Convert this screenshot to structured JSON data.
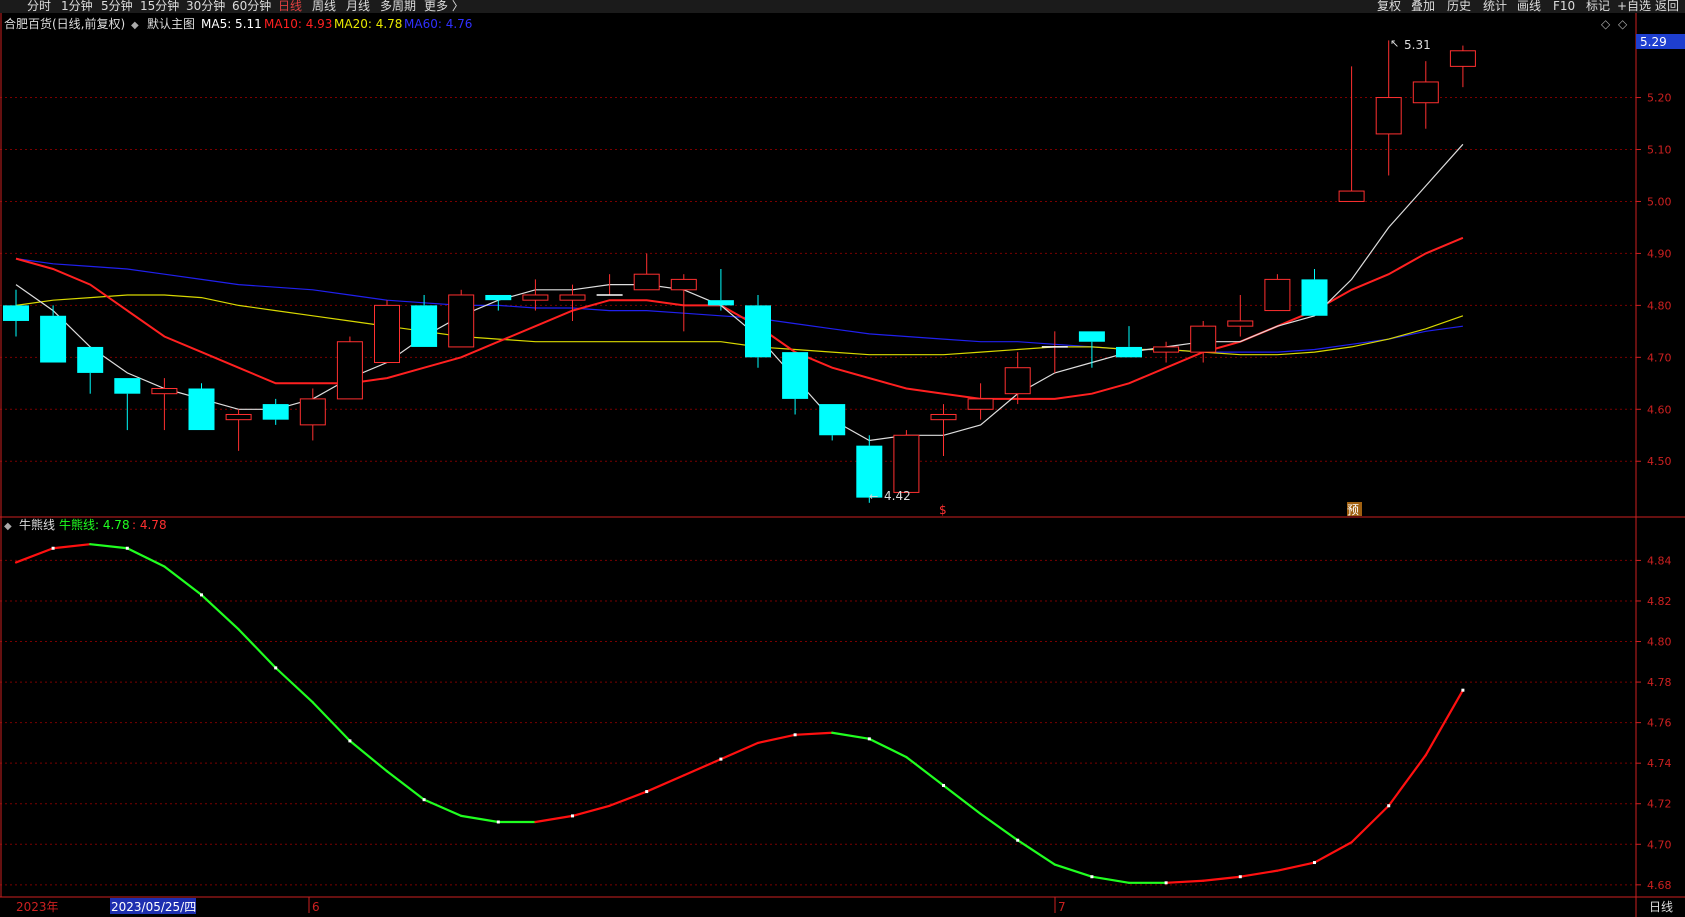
{
  "toolbar": {
    "left": [
      {
        "label": "分时",
        "active": false
      },
      {
        "label": "1分钟",
        "active": false
      },
      {
        "label": "5分钟",
        "active": false
      },
      {
        "label": "15分钟",
        "active": false
      },
      {
        "label": "30分钟",
        "active": false
      },
      {
        "label": "60分钟",
        "active": false
      },
      {
        "label": "日线",
        "active": true
      },
      {
        "label": "周线",
        "active": false
      },
      {
        "label": "月线",
        "active": false
      },
      {
        "label": "多周期",
        "active": false
      },
      {
        "label": "更多 〉",
        "active": false
      }
    ],
    "right": [
      "复权",
      "叠加",
      "历史",
      "统计",
      "画线",
      "F10",
      "标记",
      "+自选",
      "返回"
    ]
  },
  "main_panel": {
    "title": "合肥百货(日线,前复权)",
    "template": "默认主图",
    "indicators": [
      {
        "label": "MA5: 5.11",
        "color": "#ffffff"
      },
      {
        "label": "MA10: 4.93",
        "color": "#ff2020"
      },
      {
        "label": "MA20: 4.78",
        "color": "#e8e800"
      },
      {
        "label": "MA60: 4.76",
        "color": "#3030ff"
      }
    ],
    "price_tag": "5.29",
    "high_label": "5.31",
    "low_label": "4.42",
    "markers": [
      "$",
      "预"
    ]
  },
  "sub_panel": {
    "title": "牛熊线",
    "value_label": "牛熊线: 4.78",
    "value2": ": 4.78"
  },
  "footer": {
    "year": "2023年",
    "cursor_date": "2023/05/25/四",
    "month_labels": [
      "6",
      "7"
    ],
    "period": "日线"
  },
  "colors": {
    "up": "#ff3030",
    "down": "#00ffff",
    "ma5": "#dddddd",
    "ma10": "#ff2020",
    "ma20": "#d8d800",
    "ma60": "#2020ee",
    "bull": "#ff1010",
    "bear": "#20ff20",
    "grid": "#7a0000",
    "axis": "#cc2020"
  },
  "chart_data": [
    {
      "type": "candlestick",
      "title": "合肥百货(日线,前复权)",
      "ylim": [
        4.41,
        5.33
      ],
      "yticks": [
        4.5,
        4.6,
        4.7,
        4.8,
        4.9,
        5.0,
        5.1,
        5.2
      ],
      "candles": [
        {
          "o": 4.8,
          "c": 4.77,
          "h": 4.83,
          "l": 4.74
        },
        {
          "o": 4.78,
          "c": 4.69,
          "h": 4.8,
          "l": 4.69
        },
        {
          "o": 4.72,
          "c": 4.67,
          "h": 4.72,
          "l": 4.63
        },
        {
          "o": 4.66,
          "c": 4.63,
          "h": 4.66,
          "l": 4.56
        },
        {
          "o": 4.63,
          "c": 4.64,
          "h": 4.66,
          "l": 4.56
        },
        {
          "o": 4.64,
          "c": 4.56,
          "h": 4.65,
          "l": 4.56
        },
        {
          "o": 4.58,
          "c": 4.59,
          "h": 4.6,
          "l": 4.52
        },
        {
          "o": 4.61,
          "c": 4.58,
          "h": 4.62,
          "l": 4.57
        },
        {
          "o": 4.57,
          "c": 4.62,
          "h": 4.64,
          "l": 4.54
        },
        {
          "o": 4.62,
          "c": 4.73,
          "h": 4.74,
          "l": 4.62
        },
        {
          "o": 4.69,
          "c": 4.8,
          "h": 4.81,
          "l": 4.69
        },
        {
          "o": 4.8,
          "c": 4.72,
          "h": 4.82,
          "l": 4.72
        },
        {
          "o": 4.72,
          "c": 4.82,
          "h": 4.83,
          "l": 4.72
        },
        {
          "o": 4.82,
          "c": 4.81,
          "h": 4.82,
          "l": 4.79
        },
        {
          "o": 4.81,
          "c": 4.82,
          "h": 4.85,
          "l": 4.79
        },
        {
          "o": 4.81,
          "c": 4.82,
          "h": 4.84,
          "l": 4.77
        },
        {
          "o": 4.82,
          "c": 4.82,
          "h": 4.86,
          "l": 4.82
        },
        {
          "o": 4.83,
          "c": 4.86,
          "h": 4.9,
          "l": 4.83
        },
        {
          "o": 4.83,
          "c": 4.85,
          "h": 4.86,
          "l": 4.75
        },
        {
          "o": 4.81,
          "c": 4.8,
          "h": 4.87,
          "l": 4.79
        },
        {
          "o": 4.8,
          "c": 4.7,
          "h": 4.82,
          "l": 4.68
        },
        {
          "o": 4.71,
          "c": 4.62,
          "h": 4.71,
          "l": 4.59
        },
        {
          "o": 4.61,
          "c": 4.55,
          "h": 4.61,
          "l": 4.54
        },
        {
          "o": 4.53,
          "c": 4.43,
          "h": 4.55,
          "l": 4.42
        },
        {
          "o": 4.44,
          "c": 4.55,
          "h": 4.56,
          "l": 4.44
        },
        {
          "o": 4.58,
          "c": 4.59,
          "h": 4.61,
          "l": 4.51
        },
        {
          "o": 4.6,
          "c": 4.62,
          "h": 4.65,
          "l": 4.58
        },
        {
          "o": 4.63,
          "c": 4.68,
          "h": 4.71,
          "l": 4.61
        },
        {
          "o": 4.72,
          "c": 4.72,
          "h": 4.75,
          "l": 4.67
        },
        {
          "o": 4.75,
          "c": 4.73,
          "h": 4.75,
          "l": 4.68
        },
        {
          "o": 4.72,
          "c": 4.7,
          "h": 4.76,
          "l": 4.7
        },
        {
          "o": 4.71,
          "c": 4.72,
          "h": 4.73,
          "l": 4.69
        },
        {
          "o": 4.71,
          "c": 4.76,
          "h": 4.77,
          "l": 4.69
        },
        {
          "o": 4.76,
          "c": 4.77,
          "h": 4.82,
          "l": 4.74
        },
        {
          "o": 4.79,
          "c": 4.85,
          "h": 4.86,
          "l": 4.79
        },
        {
          "o": 4.85,
          "c": 4.78,
          "h": 4.87,
          "l": 4.78
        },
        {
          "o": 5.0,
          "c": 5.02,
          "h": 5.26,
          "l": 5.0
        },
        {
          "o": 5.13,
          "c": 5.2,
          "h": 5.31,
          "l": 5.05
        },
        {
          "o": 5.19,
          "c": 5.23,
          "h": 5.27,
          "l": 5.14
        },
        {
          "o": 5.26,
          "c": 5.29,
          "h": 5.3,
          "l": 5.22
        }
      ],
      "ma5": [
        4.84,
        4.79,
        4.72,
        4.67,
        4.64,
        4.62,
        4.6,
        4.6,
        4.62,
        4.66,
        4.69,
        4.74,
        4.78,
        4.81,
        4.83,
        4.83,
        4.84,
        4.84,
        4.83,
        4.8,
        4.74,
        4.66,
        4.58,
        4.54,
        4.55,
        4.55,
        4.57,
        4.63,
        4.67,
        4.69,
        4.71,
        4.72,
        4.73,
        4.73,
        4.76,
        4.78,
        4.85,
        4.95,
        5.03,
        5.11
      ],
      "ma10": [
        4.89,
        4.87,
        4.84,
        4.79,
        4.74,
        4.71,
        4.68,
        4.65,
        4.65,
        4.65,
        4.66,
        4.68,
        4.7,
        4.73,
        4.76,
        4.79,
        4.81,
        4.81,
        4.8,
        4.8,
        4.76,
        4.71,
        4.68,
        4.66,
        4.64,
        4.63,
        4.62,
        4.62,
        4.62,
        4.63,
        4.65,
        4.68,
        4.71,
        4.73,
        4.76,
        4.79,
        4.83,
        4.86,
        4.9,
        4.93
      ],
      "ma20": [
        4.8,
        4.81,
        4.815,
        4.82,
        4.82,
        4.815,
        4.8,
        4.79,
        4.78,
        4.77,
        4.76,
        4.75,
        4.74,
        4.735,
        4.73,
        4.73,
        4.73,
        4.73,
        4.73,
        4.73,
        4.72,
        4.715,
        4.71,
        4.705,
        4.705,
        4.705,
        4.71,
        4.715,
        4.72,
        4.72,
        4.715,
        4.715,
        4.71,
        4.705,
        4.705,
        4.71,
        4.72,
        4.735,
        4.755,
        4.78
      ],
      "ma60": [
        4.89,
        4.88,
        4.875,
        4.87,
        4.86,
        4.85,
        4.84,
        4.835,
        4.83,
        4.82,
        4.81,
        4.805,
        4.8,
        4.8,
        4.795,
        4.795,
        4.79,
        4.79,
        4.785,
        4.78,
        4.775,
        4.765,
        4.755,
        4.745,
        4.74,
        4.735,
        4.73,
        4.73,
        4.725,
        4.72,
        4.715,
        4.715,
        4.71,
        4.71,
        4.71,
        4.715,
        4.725,
        4.735,
        4.75,
        4.76
      ]
    },
    {
      "type": "line",
      "title": "牛熊线",
      "ylim": [
        4.674,
        4.855
      ],
      "yticks": [
        4.68,
        4.7,
        4.72,
        4.74,
        4.76,
        4.78,
        4.8,
        4.82,
        4.84
      ],
      "series": [
        {
          "name": "牛熊线",
          "values": [
            4.839,
            4.846,
            4.848,
            4.846,
            4.837,
            4.823,
            4.806,
            4.787,
            4.77,
            4.751,
            4.736,
            4.722,
            4.714,
            4.711,
            4.711,
            4.714,
            4.719,
            4.726,
            4.734,
            4.742,
            4.75,
            4.754,
            4.755,
            4.752,
            4.743,
            4.729,
            4.715,
            4.702,
            4.69,
            4.684,
            4.681,
            4.681,
            4.682,
            4.684,
            4.687,
            4.691,
            4.701,
            4.719,
            4.744,
            4.776
          ]
        }
      ],
      "direction": [
        "bull",
        "bull",
        "bear",
        "bear",
        "bear",
        "bear",
        "bear",
        "bear",
        "bear",
        "bear",
        "bear",
        "bear",
        "bear",
        "bear",
        "bull",
        "bull",
        "bull",
        "bull",
        "bull",
        "bull",
        "bull",
        "bull",
        "bear",
        "bear",
        "bear",
        "bear",
        "bear",
        "bear",
        "bear",
        "bear",
        "bear",
        "bull",
        "bull",
        "bull",
        "bull",
        "bull",
        "bull",
        "bull",
        "bull",
        "bull"
      ]
    }
  ]
}
